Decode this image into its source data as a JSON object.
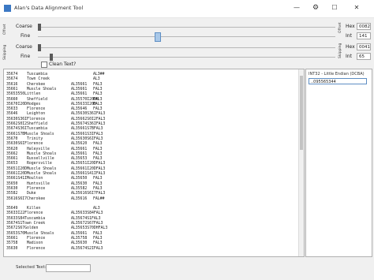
{
  "window": {
    "title": "Alan's Data Alignment Tool"
  },
  "offset_group": {
    "side_label": "Offset",
    "coarse_label": "Coarse",
    "fine_label": "Fine",
    "hex_label": "Hex",
    "int_label": "Int",
    "hex_value": "0082",
    "int_value": "141"
  },
  "skipping_group": {
    "side_label_left": "Skipping",
    "side_label_right": "Skipping",
    "coarse_label": "Coarse",
    "fine_label": "Fine",
    "hex_label": "Hex",
    "int_label": "Int",
    "hex_value": "0041",
    "int_value": "65"
  },
  "clean_text": {
    "label": "Clean Text?"
  },
  "records": [
    {
      "a": "35674    Tuscumbia",
      "b": "",
      "c": "AL3##"
    },
    {
      "a": "35674    Town Creek",
      "b": "",
      "c": "AL3"
    },
    {
      "a": "35616    Cherokee",
      "b": "AL35661",
      "c": "FAL3"
    },
    {
      "a": "35661    Muscle Shoals",
      "b": "AL35661",
      "c": "FAL3"
    },
    {
      "a": "35653550Littlen",
      "b": "AL35661",
      "c": "FAL3"
    },
    {
      "a": "35660    Sheffield",
      "b": "AL35570I20DM",
      "c": "FAL3"
    },
    {
      "a": "35670I20DHodges",
      "b": "AL35633I20D",
      "c": "FAL3"
    },
    {
      "a": "35633    Florence",
      "b": "AL35646",
      "c": "FAL3"
    },
    {
      "a": "35646    Leighton",
      "b": "AL35630S36IFAL3",
      "c": ""
    },
    {
      "a": "35630S36IFlorence",
      "b": "AL35662S0I2FAL3",
      "c": ""
    },
    {
      "a": "35662S0I2Sheffield",
      "b": "AL35674S36IFAL3",
      "c": ""
    },
    {
      "a": "35674S36ITuscumbia",
      "b": "AL35661S7BFAL3",
      "c": ""
    },
    {
      "a": "35661S7BMuscle Shoals",
      "b": "AL35661S3IFAL3",
      "c": ""
    },
    {
      "a": "35670    Trinity",
      "b": "AL35630S6IFAL3",
      "c": ""
    },
    {
      "a": "35630S6IFlorence",
      "b": "AL35620",
      "c": "FAL3"
    },
    {
      "a": "35620    Haleyville",
      "b": "AL35661",
      "c": "FAL3"
    },
    {
      "a": "35662    Muscle Shoals",
      "b": "AL35661",
      "c": "FAL3"
    },
    {
      "a": "35661    Russellville",
      "b": "AL35653",
      "c": "FAL3"
    },
    {
      "a": "35653    Rogersville",
      "b": "AL35651I20DFAL3",
      "c": ""
    },
    {
      "a": "35651I20DMuscle Shoals",
      "b": "AL35661I20DFAL3",
      "c": ""
    },
    {
      "a": "35661I20DMuscle Shoals",
      "b": "AL35661S41IFAL3",
      "c": ""
    },
    {
      "a": "35661S41IMoulton",
      "b": "AL35650",
      "c": "FAL3"
    },
    {
      "a": "35650    Huntsville",
      "b": "AL35630",
      "c": "FAL3"
    },
    {
      "a": "35630    Florence",
      "b": "AL35582",
      "c": "FAL3"
    },
    {
      "a": "35582    Duke",
      "b": "AL35616S6I7FAL3",
      "c": ""
    },
    {
      "a": "35616S6I7Cherokee",
      "b": "AL35616",
      "c": "FAL##"
    },
    {
      "a": "",
      "b": "",
      "c": ""
    },
    {
      "a": "35649    Killen",
      "b": "",
      "c": "AL3"
    },
    {
      "a": "35633I22Florence",
      "b": "AL35633S84FAL3",
      "c": ""
    },
    {
      "a": "35633S84Tuscumbia",
      "b": "AL35674S1FAL3",
      "c": ""
    },
    {
      "a": "35674S1Town Creek",
      "b": "AL35672S67FAL3",
      "c": ""
    },
    {
      "a": "35672S67Golden",
      "b": "AL35653S70DHFAL3",
      "c": ""
    },
    {
      "a": "35653S70Muscle Shoals",
      "b": "AL35661",
      "c": "FAL3"
    },
    {
      "a": "35661    Florence",
      "b": "AL35758",
      "c": "FAL3"
    },
    {
      "a": "35758    Madison",
      "b": "AL35630",
      "c": "FAL3"
    },
    {
      "a": "35630    Florence",
      "b": "AL35674S2IFAL3",
      "c": ""
    }
  ],
  "interpreter": {
    "label": "INT32 - Little Endian (DCBA)",
    "value": "..095565344"
  },
  "footer": {
    "selected_label": "Selected Text:"
  }
}
